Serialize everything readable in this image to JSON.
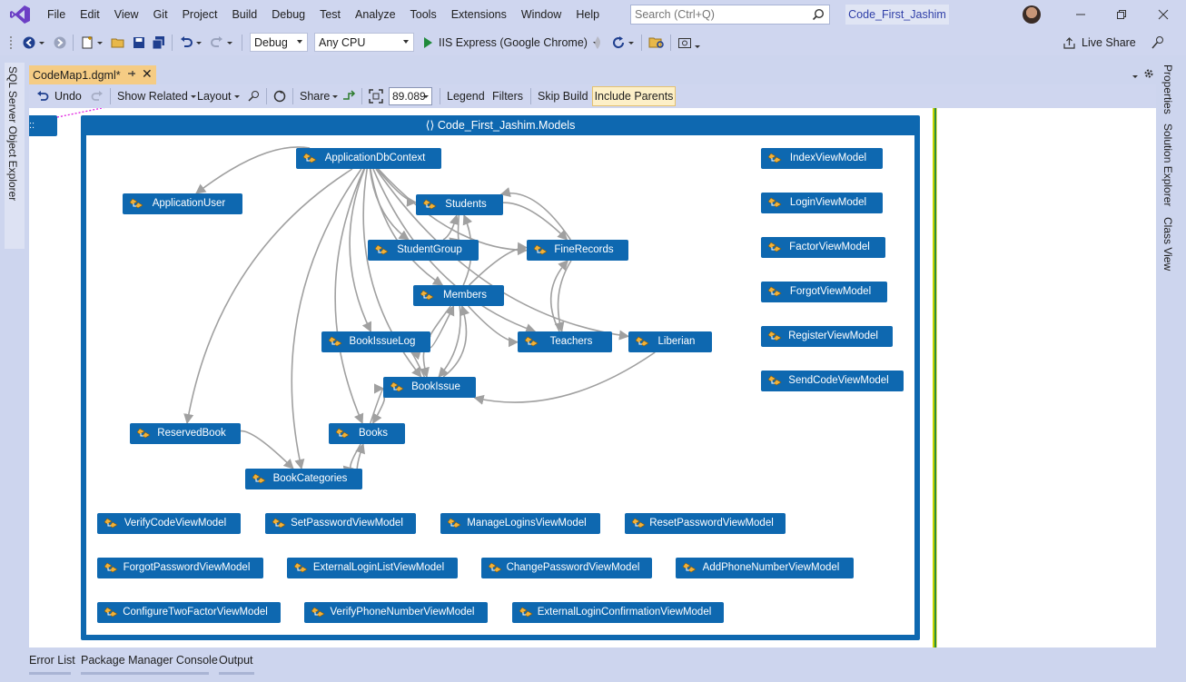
{
  "menu": {
    "items": [
      "File",
      "Edit",
      "View",
      "Git",
      "Project",
      "Build",
      "Debug",
      "Test",
      "Analyze",
      "Tools",
      "Extensions",
      "Window",
      "Help"
    ]
  },
  "search": {
    "placeholder": "Search (Ctrl+Q)"
  },
  "solution_name": "Code_First_Jashim",
  "toolbar": {
    "config": "Debug",
    "platform": "Any CPU",
    "run_label": "IIS Express (Google Chrome)",
    "live_share": "Live Share"
  },
  "side_tabs": {
    "left": "SQL Server Object Explorer",
    "right": [
      "Properties",
      "Solution Explorer",
      "Class View"
    ]
  },
  "document_tab": {
    "title": "CodeMap1.dgml*"
  },
  "map_toolbar": {
    "undo": "Undo",
    "show_related": "Show Related",
    "layout": "Layout",
    "share": "Share",
    "zoom": "89.089",
    "legend": "Legend",
    "filters": "Filters",
    "skip_build": "Skip Build",
    "include_parents": "Include Parents"
  },
  "codemap": {
    "stub_label": "::",
    "group_title": "Code_First_Jashim.Models",
    "nodes": [
      {
        "id": "ApplicationDbContext",
        "label": "ApplicationDbContext"
      },
      {
        "id": "ApplicationUser",
        "label": "ApplicationUser"
      },
      {
        "id": "Students",
        "label": "Students"
      },
      {
        "id": "StudentGroup",
        "label": "StudentGroup"
      },
      {
        "id": "FineRecords",
        "label": "FineRecords"
      },
      {
        "id": "Members",
        "label": "Members"
      },
      {
        "id": "BookIssueLog",
        "label": "BookIssueLog"
      },
      {
        "id": "Teachers",
        "label": "Teachers"
      },
      {
        "id": "Liberian",
        "label": "Liberian"
      },
      {
        "id": "BookIssue",
        "label": "BookIssue"
      },
      {
        "id": "ReservedBook",
        "label": "ReservedBook"
      },
      {
        "id": "Books",
        "label": "Books"
      },
      {
        "id": "BookCategories",
        "label": "BookCategories"
      },
      {
        "id": "IndexViewModel",
        "label": "IndexViewModel"
      },
      {
        "id": "LoginViewModel",
        "label": "LoginViewModel"
      },
      {
        "id": "FactorViewModel",
        "label": "FactorViewModel"
      },
      {
        "id": "ForgotViewModel",
        "label": "ForgotViewModel"
      },
      {
        "id": "RegisterViewModel",
        "label": "RegisterViewModel"
      },
      {
        "id": "SendCodeViewModel",
        "label": "SendCodeViewModel"
      },
      {
        "id": "VerifyCodeViewModel",
        "label": "VerifyCodeViewModel"
      },
      {
        "id": "SetPasswordViewModel",
        "label": "SetPasswordViewModel"
      },
      {
        "id": "ManageLoginsViewModel",
        "label": "ManageLoginsViewModel"
      },
      {
        "id": "ResetPasswordViewModel",
        "label": "ResetPasswordViewModel"
      },
      {
        "id": "ForgotPasswordViewModel",
        "label": "ForgotPasswordViewModel"
      },
      {
        "id": "ExternalLoginListViewModel",
        "label": "ExternalLoginListViewModel"
      },
      {
        "id": "ChangePasswordViewModel",
        "label": "ChangePasswordViewModel"
      },
      {
        "id": "AddPhoneNumberViewModel",
        "label": "AddPhoneNumberViewModel"
      },
      {
        "id": "ConfigureTwoFactorViewModel",
        "label": "ConfigureTwoFactorViewModel"
      },
      {
        "id": "VerifyPhoneNumberViewModel",
        "label": "VerifyPhoneNumberViewModel"
      },
      {
        "id": "ExternalLoginConfirmationViewModel",
        "label": "ExternalLoginConfirmationViewModel"
      }
    ],
    "edges": [
      [
        "ApplicationDbContext",
        "ApplicationUser"
      ],
      [
        "ApplicationDbContext",
        "Students"
      ],
      [
        "ApplicationDbContext",
        "StudentGroup"
      ],
      [
        "ApplicationDbContext",
        "FineRecords"
      ],
      [
        "ApplicationDbContext",
        "Members"
      ],
      [
        "ApplicationDbContext",
        "BookIssueLog"
      ],
      [
        "ApplicationDbContext",
        "Teachers"
      ],
      [
        "ApplicationDbContext",
        "Liberian"
      ],
      [
        "ApplicationDbContext",
        "BookIssue"
      ],
      [
        "ApplicationDbContext",
        "ReservedBook"
      ],
      [
        "ApplicationDbContext",
        "Books"
      ],
      [
        "ApplicationDbContext",
        "BookCategories"
      ],
      [
        "StudentGroup",
        "Students"
      ],
      [
        "Students",
        "StudentGroup"
      ],
      [
        "Students",
        "FineRecords"
      ],
      [
        "FineRecords",
        "Students"
      ],
      [
        "Members",
        "Students"
      ],
      [
        "Members",
        "FineRecords"
      ],
      [
        "FineRecords",
        "Teachers"
      ],
      [
        "Teachers",
        "FineRecords"
      ],
      [
        "Members",
        "Teachers"
      ],
      [
        "Members",
        "BookIssueLog"
      ],
      [
        "BookIssueLog",
        "Members"
      ],
      [
        "Members",
        "BookIssue"
      ],
      [
        "BookIssue",
        "Members"
      ],
      [
        "BookIssue",
        "BookIssueLog"
      ],
      [
        "BookIssueLog",
        "BookIssue"
      ],
      [
        "Liberian",
        "BookIssue"
      ],
      [
        "BookIssue",
        "Books"
      ],
      [
        "Books",
        "BookIssue"
      ],
      [
        "ReservedBook",
        "BookCategories"
      ],
      [
        "Books",
        "BookCategories"
      ],
      [
        "BookCategories",
        "Books"
      ]
    ]
  },
  "bottom_tabs": [
    "Error List",
    "Package Manager Console",
    "Output"
  ]
}
